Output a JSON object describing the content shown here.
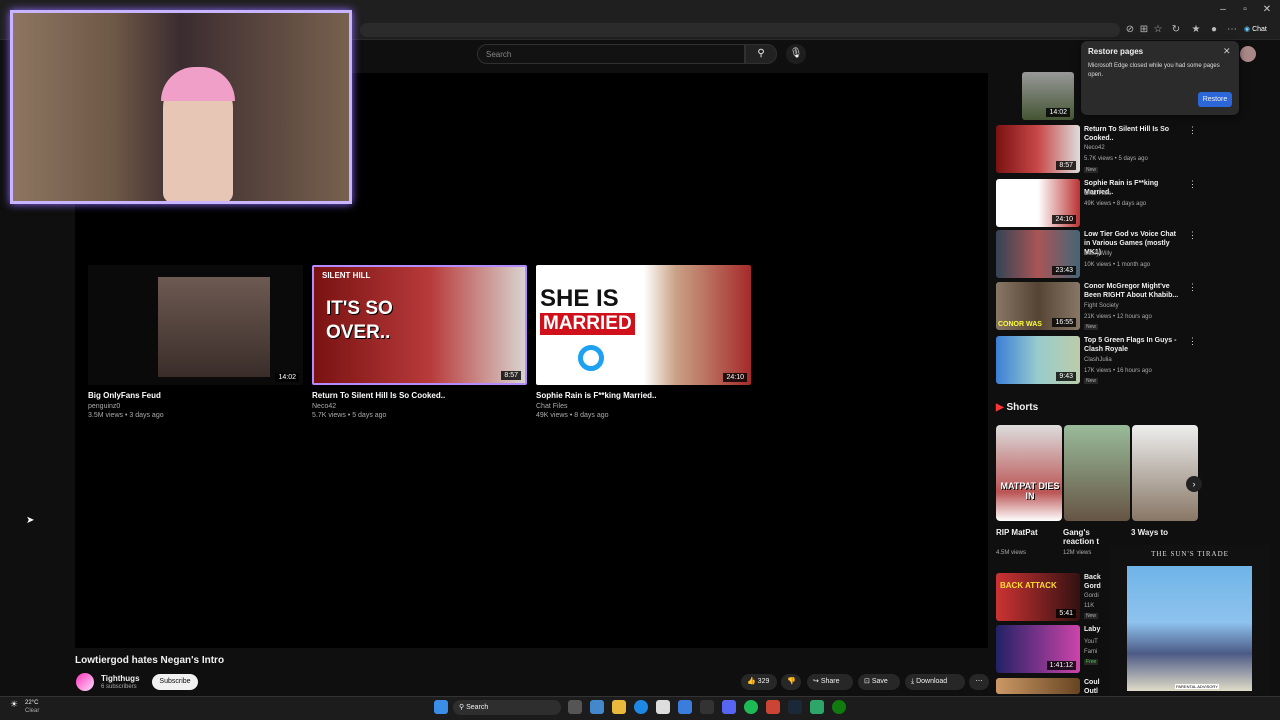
{
  "header": {
    "search_placeholder": "Search"
  },
  "browser": {
    "chat_label": "Chat"
  },
  "restore_popup": {
    "title": "Restore pages",
    "message": "Microsoft Edge closed while you had some pages open.",
    "button": "Restore"
  },
  "endcards": [
    {
      "title": "Big OnlyFans Feud",
      "meta": "penguinz0",
      "stats": "3.5M views • 3 days ago",
      "duration": "14:02"
    },
    {
      "title": "Return To Silent Hill Is So Cooked..",
      "meta": "Neco42",
      "stats": "5.7K views • 5 days ago",
      "duration": "8:57",
      "thumb_text_top": "SILENT HILL",
      "thumb_text_main": "IT'S SO OVER.."
    },
    {
      "title": "Sophie Rain is F**king Married..",
      "meta": "Chat Files",
      "stats": "49K views • 8 days ago",
      "duration": "24:10",
      "thumb_text_1": "SHE IS",
      "thumb_text_2": "MARRIED"
    }
  ],
  "video": {
    "title": "Lowtiergod hates Negan's Intro",
    "channel": "Tighthugs",
    "subscribers": "6 subscribers",
    "subscribe": "Subscribe",
    "likes": "329",
    "share": "Share",
    "save": "Save",
    "download": "Download"
  },
  "sidebar": {
    "recs": [
      {
        "duration": "14:02"
      },
      {
        "title": "Return To Silent Hill Is So Cooked..",
        "channel": "Neco42",
        "stats": "5.7K views • 5 days ago",
        "badge": "New",
        "duration": "8:57"
      },
      {
        "title": "Sophie Rain is F**king Married..",
        "channel": "Chat Files",
        "stats": "49K views • 8 days ago",
        "duration": "24:10"
      },
      {
        "title": "Low Tier God vs Voice Chat in Various Games (mostly MK1)",
        "channel": "DaleyWilly",
        "stats": "10K views • 1 month ago",
        "duration": "23:43"
      },
      {
        "title": "Conor McGregor Might've Been RIGHT About Khabib...",
        "channel": "Fight Society",
        "stats": "21K views • 12 hours ago",
        "badge": "New",
        "duration": "16:55",
        "thumb_text": "CONOR WAS"
      },
      {
        "title": "Top 5 Green Flags In Guys - Clash Royale",
        "channel": "ClashJulia",
        "stats": "17K views • 16 hours ago",
        "badge": "New",
        "duration": "9:43"
      }
    ],
    "shorts_heading": "Shorts",
    "shorts": [
      {
        "title": "RIP MatPat",
        "views": "4.5M views",
        "thumb_text": "MATPAT DIES IN"
      },
      {
        "title": "Gang's reaction t",
        "views": "12M views"
      },
      {
        "title": "3 Ways to",
        "views": ""
      }
    ],
    "lower_recs": [
      {
        "title": "Back Gord",
        "channel": "Gordi",
        "stats": "11K",
        "badge": "New",
        "duration": "5:41",
        "thumb_text": "BACK ATTACK"
      },
      {
        "title": "Laby",
        "channel": "YouT",
        "stats": "Fami",
        "badge": "Free",
        "duration": "1:41:12"
      },
      {
        "title": "Coul Outl"
      }
    ]
  },
  "music_overlay": {
    "title": "THE SUN'S TIRADE",
    "label": "PARENTAL ADVISORY"
  },
  "taskbar": {
    "weather_temp": "22°C",
    "weather_desc": "Clear",
    "search": "Search"
  }
}
